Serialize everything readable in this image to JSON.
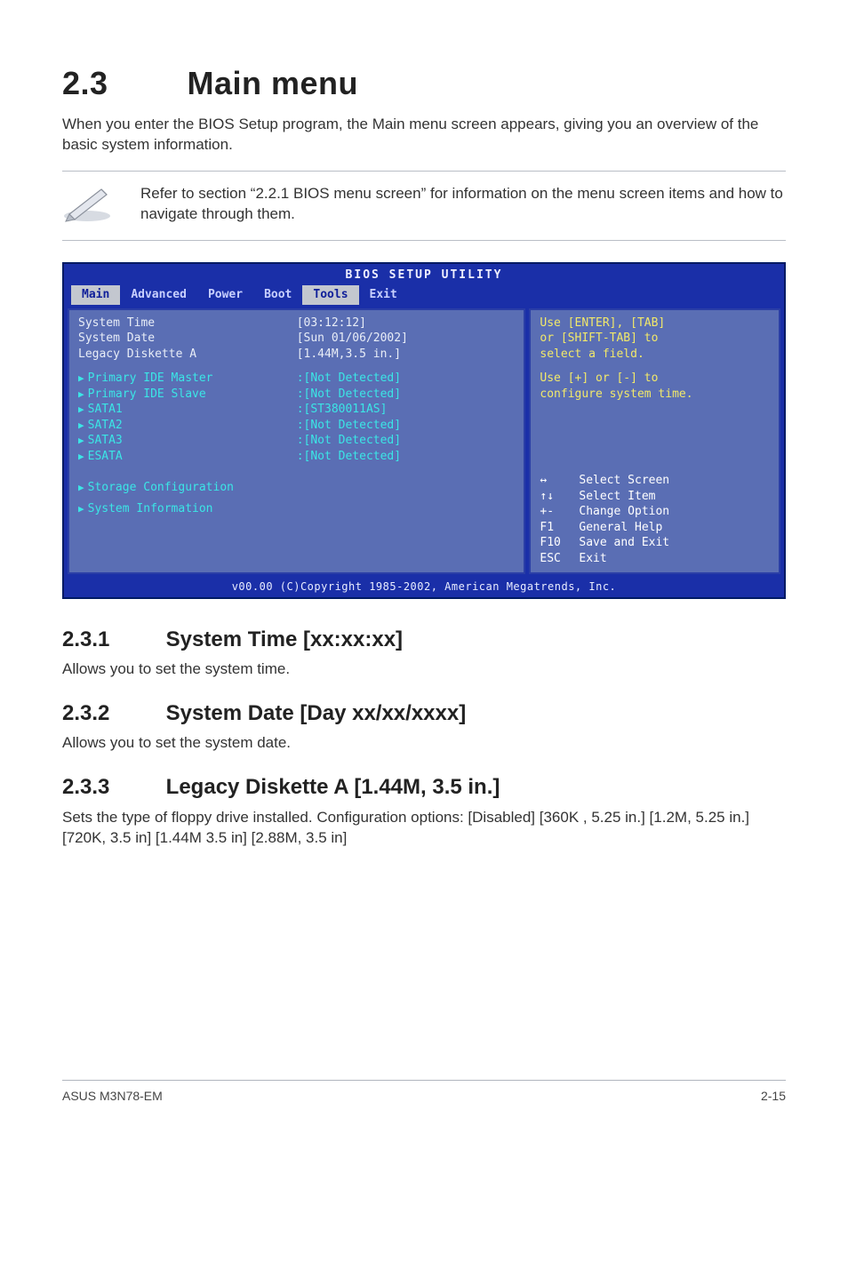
{
  "page": {
    "title_num": "2.3",
    "title_text": "Main menu",
    "intro": "When you enter the BIOS Setup program, the Main menu screen appears, giving you an overview of the basic system information.",
    "note": "Refer to section “2.2.1 BIOS menu screen” for information on the menu screen items and how to navigate through them."
  },
  "bios": {
    "caption": "BIOS SETUP UTILITY",
    "tabs": [
      "Main",
      "Advanced",
      "Power",
      "Boot",
      "Tools",
      "Exit"
    ],
    "items": [
      {
        "label": "System Time",
        "value": "[03:12:12]",
        "style": "selected"
      },
      {
        "label": "System Date",
        "value": "[Sun 01/06/2002]",
        "style": "selected"
      },
      {
        "label": "Legacy Diskette A",
        "value": "[1.44M,3.5 in.]",
        "style": "selected"
      }
    ],
    "devices": [
      {
        "label": "Primary IDE Master",
        "value": ":[Not Detected]"
      },
      {
        "label": "Primary IDE Slave",
        "value": ":[Not Detected]"
      },
      {
        "label": "SATA1",
        "value": ":[ST380011AS]"
      },
      {
        "label": "SATA2",
        "value": ":[Not Detected]"
      },
      {
        "label": "SATA3",
        "value": ":[Not Detected]"
      },
      {
        "label": "ESATA",
        "value": ":[Not Detected]"
      }
    ],
    "menus": [
      "Storage Configuration",
      "System Information"
    ],
    "help": {
      "lines": [
        "Use [ENTER], [TAB]",
        "or [SHIFT-TAB] to",
        "select a field.",
        "",
        "Use [+] or [-] to",
        "configure system time."
      ],
      "hotkeys": [
        {
          "key": "↔",
          "text": "Select Screen"
        },
        {
          "key": "↑↓",
          "text": "Select Item"
        },
        {
          "key": "+-",
          "text": "Change Option"
        },
        {
          "key": "F1",
          "text": "General Help"
        },
        {
          "key": "F10",
          "text": "Save and Exit"
        },
        {
          "key": "ESC",
          "text": "Exit"
        }
      ]
    },
    "footer": "v00.00 (C)Copyright 1985-2002, American Megatrends, Inc."
  },
  "sub": [
    {
      "num": "2.3.1",
      "title": "System Time [xx:xx:xx]",
      "body": "Allows you to set the system time."
    },
    {
      "num": "2.3.2",
      "title": "System Date [Day xx/xx/xxxx]",
      "body": "Allows you to set the system date."
    },
    {
      "num": "2.3.3",
      "title": "Legacy Diskette A [1.44M, 3.5 in.]",
      "body": "Sets the type of floppy drive installed. Configuration options: [Disabled] [360K , 5.25 in.] [1.2M, 5.25 in.] [720K, 3.5 in] [1.44M 3.5 in] [2.88M, 3.5 in]"
    }
  ],
  "footer": {
    "left": "ASUS M3N78-EM",
    "right": "2-15"
  }
}
